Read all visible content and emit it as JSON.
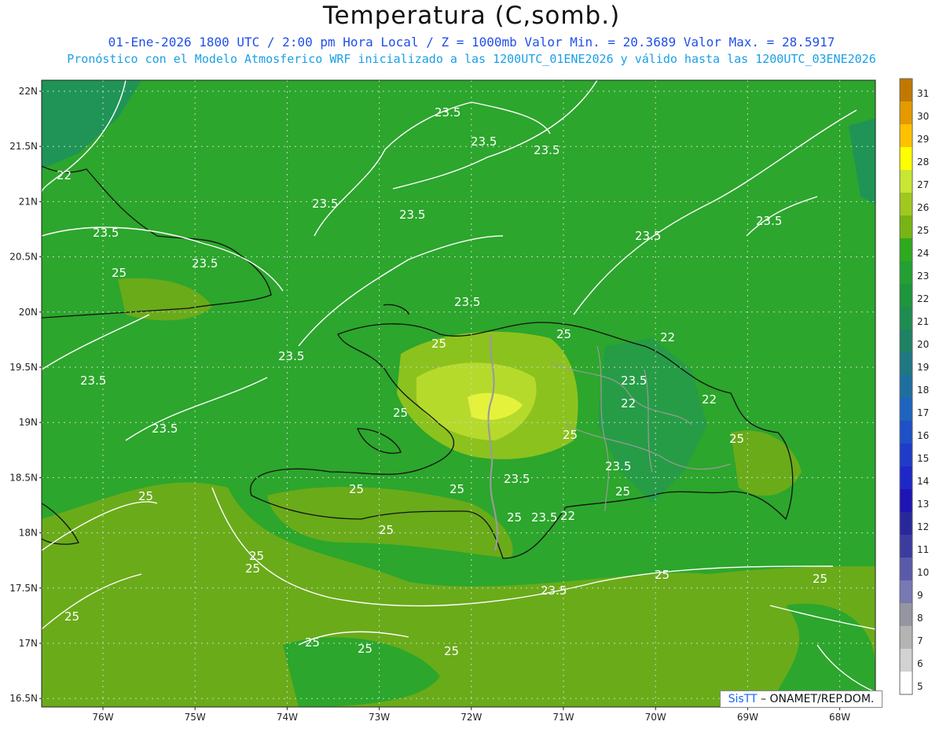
{
  "title": "Temperatura (C,somb.)",
  "subtitle": {
    "date": "01-Ene-2026",
    "utc": "1800 UTC",
    "local": "2:00 pm Hora Local",
    "level": "Z = 1000mb",
    "min": "Valor Min. = 20.3689",
    "max": "Valor Max. = 28.5917",
    "line1": "01-Ene-2026  1800 UTC / 2:00 pm Hora Local / Z = 1000mb   Valor Min. = 20.3689  Valor Max. = 28.5917",
    "line2": "Pronóstico con el Modelo Atmosferico WRF inicializado a las 1200UTC_01ENE2026 y válido hasta las  1200UTC_03ENE2026"
  },
  "credit": {
    "brand": "SisTT",
    "text": "– ONAMET/REP.DOM."
  },
  "lat_labels": [
    "22N",
    "21.5N",
    "21N",
    "20.5N",
    "20N",
    "19.5N",
    "19N",
    "18.5N",
    "18N",
    "17.5N",
    "17N",
    "16.5N"
  ],
  "lon_labels": [
    "76W",
    "75W",
    "74W",
    "73W",
    "72W",
    "71W",
    "70W",
    "69W",
    "68W"
  ],
  "colorbar": {
    "levels": [
      "31",
      "30",
      "29",
      "28",
      "27",
      "26",
      "25",
      "24",
      "23",
      "22",
      "21",
      "20",
      "19",
      "18",
      "17",
      "16",
      "15",
      "14",
      "13",
      "12",
      "11",
      "10",
      "9",
      "8",
      "7",
      "6",
      "5"
    ],
    "colors": [
      "#c07800",
      "#e59a00",
      "#ffc000",
      "#ffff00",
      "#c8e632",
      "#a0c81e",
      "#78b414",
      "#2daa1e",
      "#23a032",
      "#1e963c",
      "#1e8c50",
      "#1e8264",
      "#1e7882",
      "#1e6ea0",
      "#1e64be",
      "#1e50c8",
      "#1e3cc8",
      "#1e28c8",
      "#1e14b4",
      "#28289b",
      "#3c3ca0",
      "#5a5aaa",
      "#7878b4",
      "#9696a0",
      "#b4b4b4",
      "#d2d2d2",
      "#ffffff"
    ]
  },
  "contour_labels": [
    "23.5",
    "23.5",
    "23.5",
    "23.5",
    "23.5",
    "23.5",
    "23.5",
    "23.5",
    "23.5",
    "23.5",
    "23.5",
    "23.5",
    "23.5",
    "23.5",
    "23.5",
    "23.5",
    "22",
    "22",
    "22",
    "22",
    "22",
    "25",
    "25",
    "25",
    "25",
    "25",
    "25",
    "25",
    "25",
    "25",
    "25",
    "25",
    "25",
    "25",
    "25",
    "25",
    "25",
    "25"
  ],
  "map_colors": {
    "base": "#2ca62c",
    "warm": "#6aab1a",
    "hot": "#a8d62a",
    "hottest": "#e5f23c",
    "cool": "#1f9456",
    "coastline": "#111111",
    "border": "#9a9a9a",
    "contour": "#ffffff"
  }
}
